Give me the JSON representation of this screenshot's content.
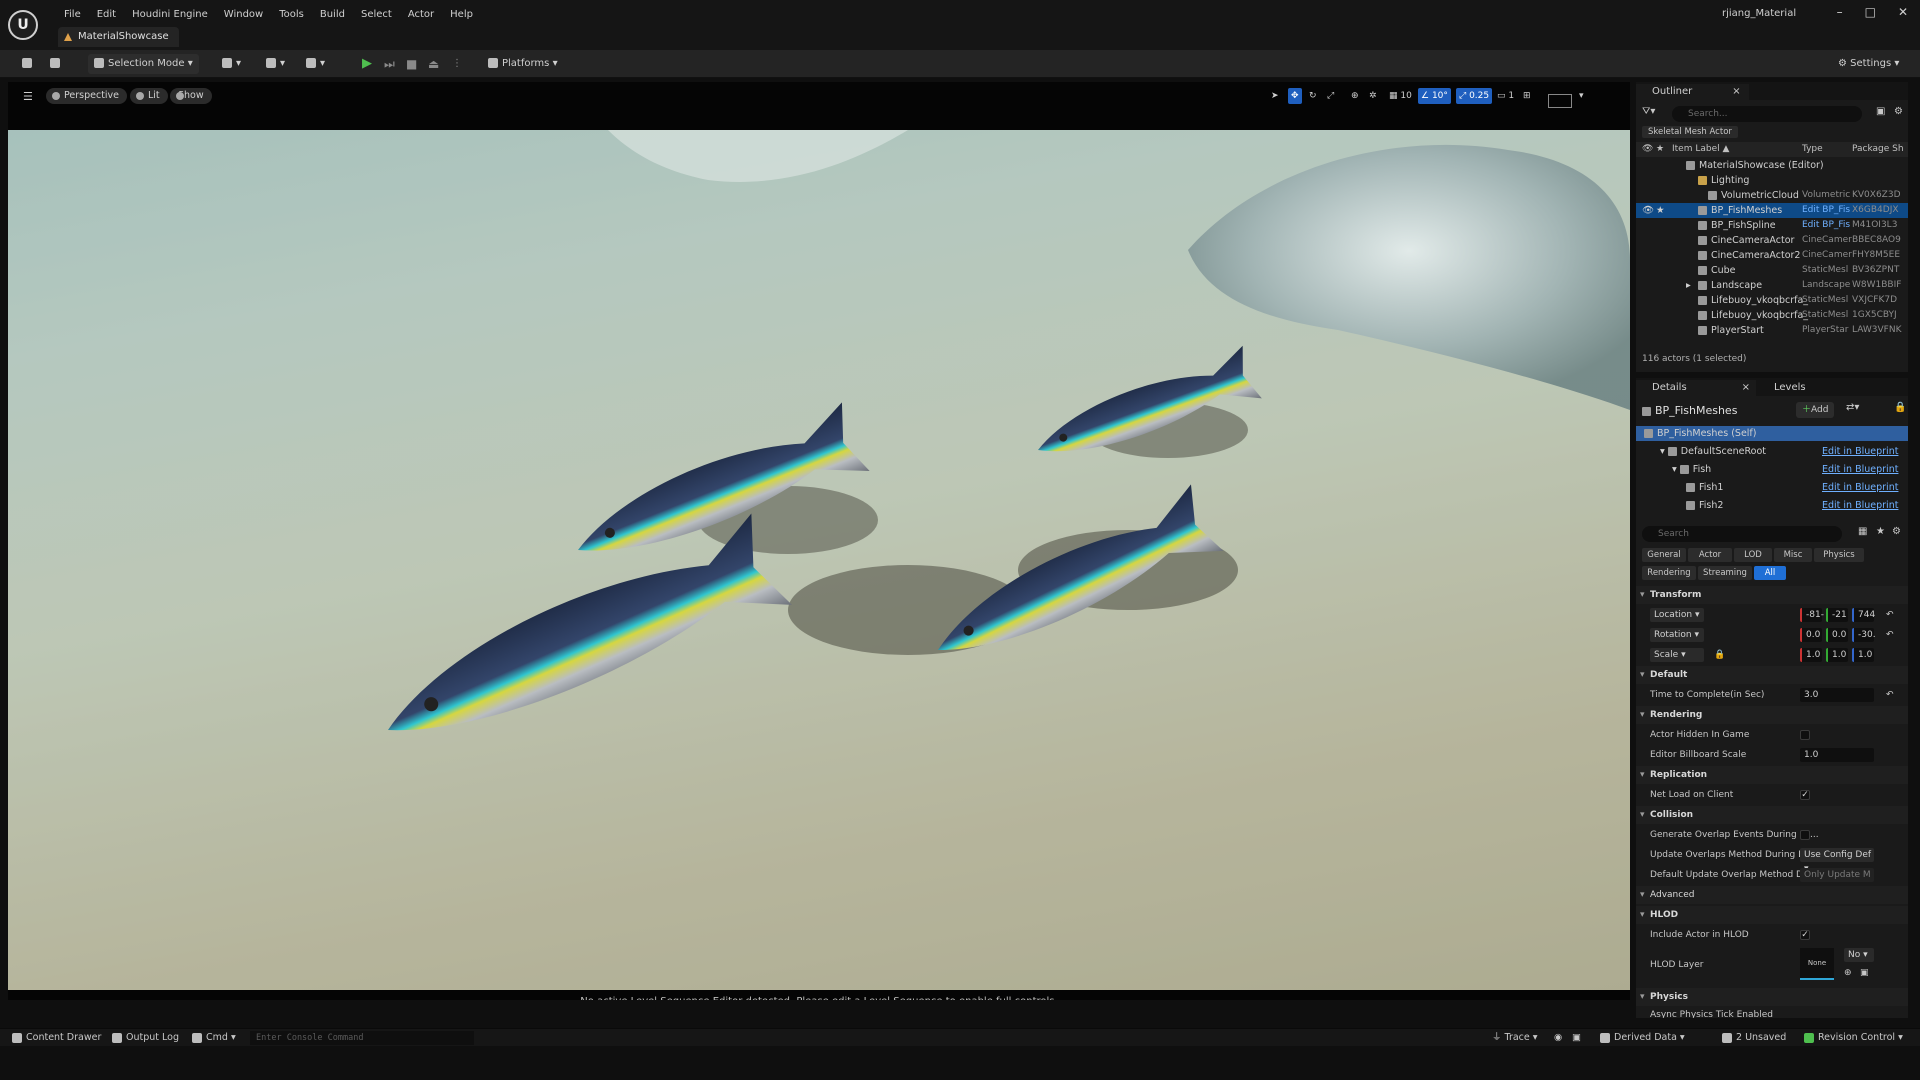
{
  "app": {
    "logo": "U",
    "project_name": "rjiang_Material",
    "tab_title": "MaterialShowcase",
    "window_buttons": [
      "–",
      "□",
      "✕"
    ]
  },
  "menu": [
    "File",
    "Edit",
    "Houdini Engine",
    "Window",
    "Tools",
    "Build",
    "Select",
    "Actor",
    "Help"
  ],
  "toolbar": {
    "selection_mode": "Selection Mode",
    "platforms": "Platforms",
    "settings": "Settings"
  },
  "viewport": {
    "perspective": "Perspective",
    "lit": "Lit",
    "show": "Show",
    "grid_snap": "10",
    "rotate_snap": "10°",
    "scale_snap": "0.25",
    "camera_speed": "1",
    "status_message": "No active Level Sequence Editor detected. Please edit a Level Sequence to enable full controls."
  },
  "outliner": {
    "tab_label": "Outliner",
    "search_placeholder": "Search...",
    "filter_chip": "Skeletal Mesh Actor",
    "columns": {
      "item_label": "Item Label ▲",
      "type": "Type",
      "package": "Package Sh"
    },
    "rows": [
      {
        "label": "MaterialShowcase (Editor)",
        "type": "",
        "package": ""
      },
      {
        "label": "Lighting",
        "type": "",
        "package": ""
      },
      {
        "label": "VolumetricCloud",
        "type": "Volumetric",
        "package": "KV0X6Z3D"
      },
      {
        "label": "BP_FishMeshes",
        "type": "Edit BP_Fis",
        "package": "X6GB4DJX"
      },
      {
        "label": "BP_FishSpline",
        "type": "Edit BP_Fis",
        "package": "M41OI3L3"
      },
      {
        "label": "CineCameraActor",
        "type": "CineCamer",
        "package": "BBEC8AO9"
      },
      {
        "label": "CineCameraActor2",
        "type": "CineCamer",
        "package": "FHY8M5EE"
      },
      {
        "label": "Cube",
        "type": "StaticMesl",
        "package": "BV36ZPNT"
      },
      {
        "label": "Landscape",
        "type": "Landscape",
        "package": "W8W1BBIF"
      },
      {
        "label": "Lifebuoy_vkoqbcrfa_",
        "type": "StaticMesl",
        "package": "VXJCFK7D"
      },
      {
        "label": "Lifebuoy_vkoqbcrfa_",
        "type": "StaticMesl",
        "package": "1GX5CBYJ"
      },
      {
        "label": "PlayerStart",
        "type": "PlayerStar",
        "package": "LAW3VFNK"
      }
    ],
    "count": "116 actors (1 selected)"
  },
  "details": {
    "tab_label": "Details",
    "levels_tab": "Levels",
    "actor_name": "BP_FishMeshes",
    "add_button": "Add",
    "components": [
      {
        "name": "BP_FishMeshes (Self)",
        "link": ""
      },
      {
        "name": "DefaultSceneRoot",
        "link": "Edit in Blueprint"
      },
      {
        "name": "Fish",
        "link": "Edit in Blueprint"
      },
      {
        "name": "Fish1",
        "link": "Edit in Blueprint"
      },
      {
        "name": "Fish2",
        "link": "Edit in Blueprint"
      }
    ],
    "search_placeholder": "Search",
    "filter_tabs_row1": [
      "General",
      "Actor",
      "LOD",
      "Misc",
      "Physics"
    ],
    "filter_tabs_row2": [
      "Rendering",
      "Streaming",
      "All"
    ],
    "transform": {
      "section": "Transform",
      "location_label": "Location",
      "location": [
        "-81-",
        "-21",
        "744"
      ],
      "rotation_label": "Rotation",
      "rotation": [
        "0.0",
        "0.0",
        "-30."
      ],
      "scale_label": "Scale",
      "scale": [
        "1.0",
        "1.0",
        "1.0"
      ]
    },
    "default": {
      "section": "Default",
      "time_label": "Time to Complete(in Sec)",
      "time_value": "3.0"
    },
    "rendering": {
      "section": "Rendering",
      "hidden_label": "Actor Hidden In Game",
      "billboard_label": "Editor Billboard Scale",
      "billboard_value": "1.0"
    },
    "replication": {
      "section": "Replication",
      "net_load_label": "Net Load on Client"
    },
    "collision": {
      "section": "Collision",
      "overlap_label": "Generate Overlap Events During Le...",
      "update_label": "Update Overlaps Method During Le...",
      "update_value": "Use Config Def",
      "default_update_label": "Default Update Overlap Method D...",
      "default_update_value": "Only Update M"
    },
    "advanced": "Advanced",
    "hlod": {
      "section": "HLOD",
      "include_label": "Include Actor in HLOD",
      "layer_label": "HLOD Layer",
      "layer_value": "None",
      "layer_dropdown": "No"
    },
    "physics": {
      "section": "Physics",
      "async_label": "Async Physics Tick Enabled"
    }
  },
  "statusbar": {
    "content_drawer": "Content Drawer",
    "output_log": "Output Log",
    "cmd": "Cmd",
    "console_placeholder": "Enter Console Command",
    "trace": "Trace",
    "derived_data": "Derived Data",
    "unsaved": "2 Unsaved",
    "revision_control": "Revision Control"
  }
}
